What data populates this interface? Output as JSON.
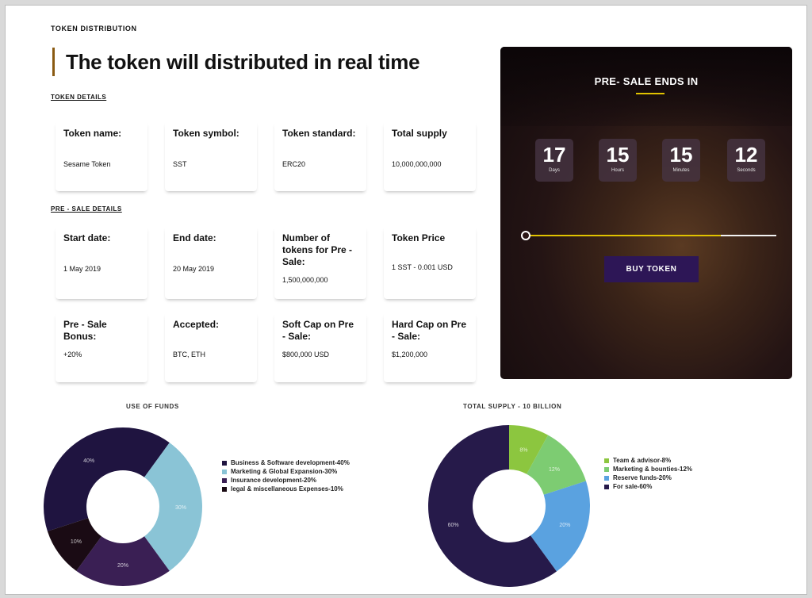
{
  "header": {
    "eyebrow": "TOKEN DISTRIBUTION",
    "title": "The token will distributed in real time"
  },
  "token_details": {
    "label": "TOKEN DETAILS",
    "cards": [
      {
        "label": "Token name:",
        "value": "Sesame Token"
      },
      {
        "label": "Token symbol:",
        "value": "SST"
      },
      {
        "label": "Token standard:",
        "value": "ERC20"
      },
      {
        "label": "Total supply",
        "value": "10,000,000,000"
      }
    ]
  },
  "presale_details": {
    "label": "PRE - SALE DETAILS",
    "cards": [
      {
        "label": "Start date:",
        "value": "1 May 2019"
      },
      {
        "label": "End date:",
        "value": "20 May 2019"
      },
      {
        "label": "Number of tokens for Pre - Sale:",
        "value": "1,500,000,000"
      },
      {
        "label": "Token Price",
        "value": "1 SST - 0.001 USD"
      },
      {
        "label": "Pre - Sale Bonus:",
        "value": "+20%"
      },
      {
        "label": "Accepted:",
        "value": "BTC, ETH"
      },
      {
        "label": "Soft Cap on Pre - Sale:",
        "value": "$800,000 USD"
      },
      {
        "label": "Hard Cap on Pre - Sale:",
        "value": "$1,200,000"
      }
    ]
  },
  "countdown": {
    "title": "PRE- SALE ENDS IN",
    "boxes": [
      {
        "value": "17",
        "unit": "Days"
      },
      {
        "value": "15",
        "unit": "Hours"
      },
      {
        "value": "15",
        "unit": "Minutes"
      },
      {
        "value": "12",
        "unit": "Seconds"
      }
    ],
    "progress": 0.78,
    "button_label": "BUY TOKEN",
    "accent": "#e0c200",
    "button_color": "#2d1656"
  },
  "chart_data": [
    {
      "type": "pie",
      "title": "USE OF FUNDS",
      "series": [
        {
          "name": "Business & Software development-40%",
          "value": 40,
          "label": "40%",
          "color": "#1f1440"
        },
        {
          "name": "Marketing & Global Expansion-30%",
          "value": 30,
          "label": "30%",
          "color": "#8ac4d6"
        },
        {
          "name": "Insurance development-20%",
          "value": 20,
          "label": "20%",
          "color": "#3a1f54"
        },
        {
          "name": "legal & miscellaneous Expenses-10%",
          "value": 10,
          "label": "10%",
          "color": "#1a0b14"
        }
      ]
    },
    {
      "type": "pie",
      "title": "TOTAL SUPPLY - 10 BILLION",
      "series": [
        {
          "name": "Team & advisor-8%",
          "value": 8,
          "label": "8%",
          "color": "#8cc63f"
        },
        {
          "name": "Marketing & bounties-12%",
          "value": 12,
          "label": "12%",
          "color": "#7dcc72"
        },
        {
          "name": "Reserve funds-20%",
          "value": 20,
          "label": "20%",
          "color": "#5aa2e0"
        },
        {
          "name": "For sale-60%",
          "value": 60,
          "label": "60%",
          "color": "#261a4a"
        }
      ]
    }
  ]
}
